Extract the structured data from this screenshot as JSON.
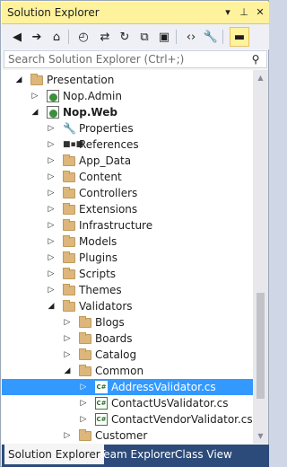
{
  "window": {
    "title": "Solution Explorer",
    "controls": {
      "dropdown": "▾",
      "pin": "📌",
      "close": "✕"
    }
  },
  "toolbar": {
    "buttons": [
      {
        "name": "back-icon",
        "glyph": "◀"
      },
      {
        "name": "forward-icon",
        "glyph": "➔"
      },
      {
        "name": "home-icon",
        "glyph": "⌂"
      },
      {
        "name": "pending-changes-icon",
        "glyph": "◴"
      },
      {
        "name": "sync-icon",
        "glyph": "⇄"
      },
      {
        "name": "refresh-icon",
        "glyph": "↻"
      },
      {
        "name": "collapse-all-icon",
        "glyph": "⧉"
      },
      {
        "name": "show-all-files-icon",
        "glyph": "▣"
      },
      {
        "name": "view-code-icon",
        "glyph": "‹›"
      },
      {
        "name": "properties-icon",
        "glyph": "🔧"
      },
      {
        "name": "preview-icon",
        "glyph": "▬"
      }
    ]
  },
  "search": {
    "placeholder": "Search Solution Explorer (Ctrl+;)",
    "icon": "search-icon"
  },
  "tree": [
    {
      "label": "Presentation",
      "icon": "folder",
      "expanded": true,
      "bold": false
    },
    {
      "label": "Nop.Admin",
      "icon": "project",
      "expanded": false,
      "bold": false
    },
    {
      "label": "Nop.Web",
      "icon": "project",
      "expanded": true,
      "bold": true
    },
    {
      "label": "Properties",
      "icon": "properties",
      "expanded": false,
      "bold": false
    },
    {
      "label": "References",
      "icon": "references",
      "expanded": false,
      "bold": false
    },
    {
      "label": "App_Data",
      "icon": "folder",
      "expanded": false,
      "bold": false
    },
    {
      "label": "Content",
      "icon": "folder",
      "expanded": false,
      "bold": false
    },
    {
      "label": "Controllers",
      "icon": "folder",
      "expanded": false,
      "bold": false
    },
    {
      "label": "Extensions",
      "icon": "folder",
      "expanded": false,
      "bold": false
    },
    {
      "label": "Infrastructure",
      "icon": "folder",
      "expanded": false,
      "bold": false
    },
    {
      "label": "Models",
      "icon": "folder",
      "expanded": false,
      "bold": false
    },
    {
      "label": "Plugins",
      "icon": "folder",
      "expanded": false,
      "bold": false
    },
    {
      "label": "Scripts",
      "icon": "folder",
      "expanded": false,
      "bold": false
    },
    {
      "label": "Themes",
      "icon": "folder",
      "expanded": false,
      "bold": false
    },
    {
      "label": "Validators",
      "icon": "folder",
      "expanded": true,
      "bold": false
    },
    {
      "label": "Blogs",
      "icon": "folder",
      "expanded": false,
      "bold": false
    },
    {
      "label": "Boards",
      "icon": "folder",
      "expanded": false,
      "bold": false
    },
    {
      "label": "Catalog",
      "icon": "folder",
      "expanded": false,
      "bold": false
    },
    {
      "label": "Common",
      "icon": "folder",
      "expanded": true,
      "bold": false
    },
    {
      "label": "AddressValidator.cs",
      "icon": "csharp-file",
      "expanded": false,
      "bold": false,
      "selected": true
    },
    {
      "label": "ContactUsValidator.cs",
      "icon": "csharp-file",
      "expanded": false,
      "bold": false
    },
    {
      "label": "ContactVendorValidator.cs",
      "icon": "csharp-file",
      "expanded": false,
      "bold": false
    },
    {
      "label": "Customer",
      "icon": "folder",
      "expanded": false,
      "bold": false
    }
  ],
  "tabs": [
    {
      "label": "Solution Explorer",
      "active": true
    },
    {
      "label": "Team Explorer",
      "active": false
    },
    {
      "label": "Class View",
      "active": false
    }
  ],
  "colors": {
    "titlebar": "#fff29d",
    "selection": "#3399ff",
    "tabstrip": "#2d4b7a"
  }
}
